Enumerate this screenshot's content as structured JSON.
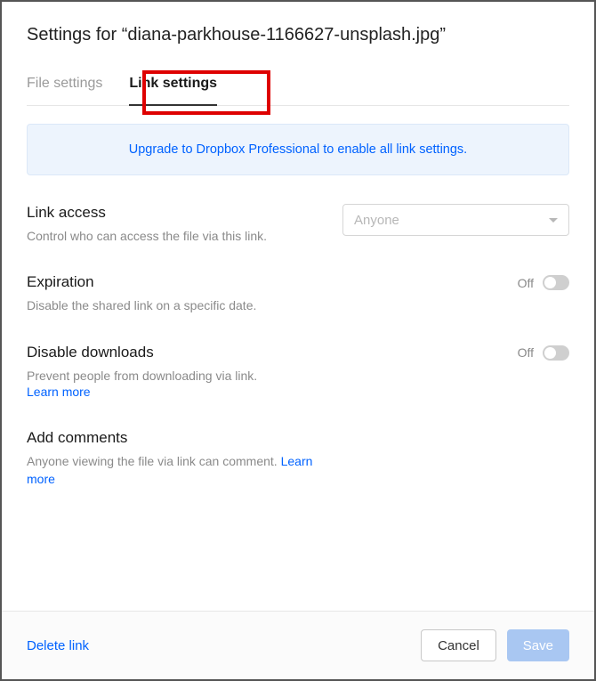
{
  "title": "Settings for “diana-parkhouse-1166627-unsplash.jpg”",
  "tabs": {
    "file": "File settings",
    "link": "Link settings"
  },
  "banner": "Upgrade to Dropbox Professional to enable all link settings.",
  "link_access": {
    "title": "Link access",
    "desc": "Control who can access the file via this link.",
    "selected": "Anyone"
  },
  "expiration": {
    "title": "Expiration",
    "desc": "Disable the shared link on a specific date.",
    "state": "Off"
  },
  "disable_downloads": {
    "title": "Disable downloads",
    "desc": "Prevent people from downloading via link.",
    "learn": "Learn more",
    "state": "Off"
  },
  "add_comments": {
    "title": "Add comments",
    "desc_pre": "Anyone viewing the file via link can comment. ",
    "learn": "Learn more"
  },
  "footer": {
    "delete": "Delete link",
    "cancel": "Cancel",
    "save": "Save"
  }
}
